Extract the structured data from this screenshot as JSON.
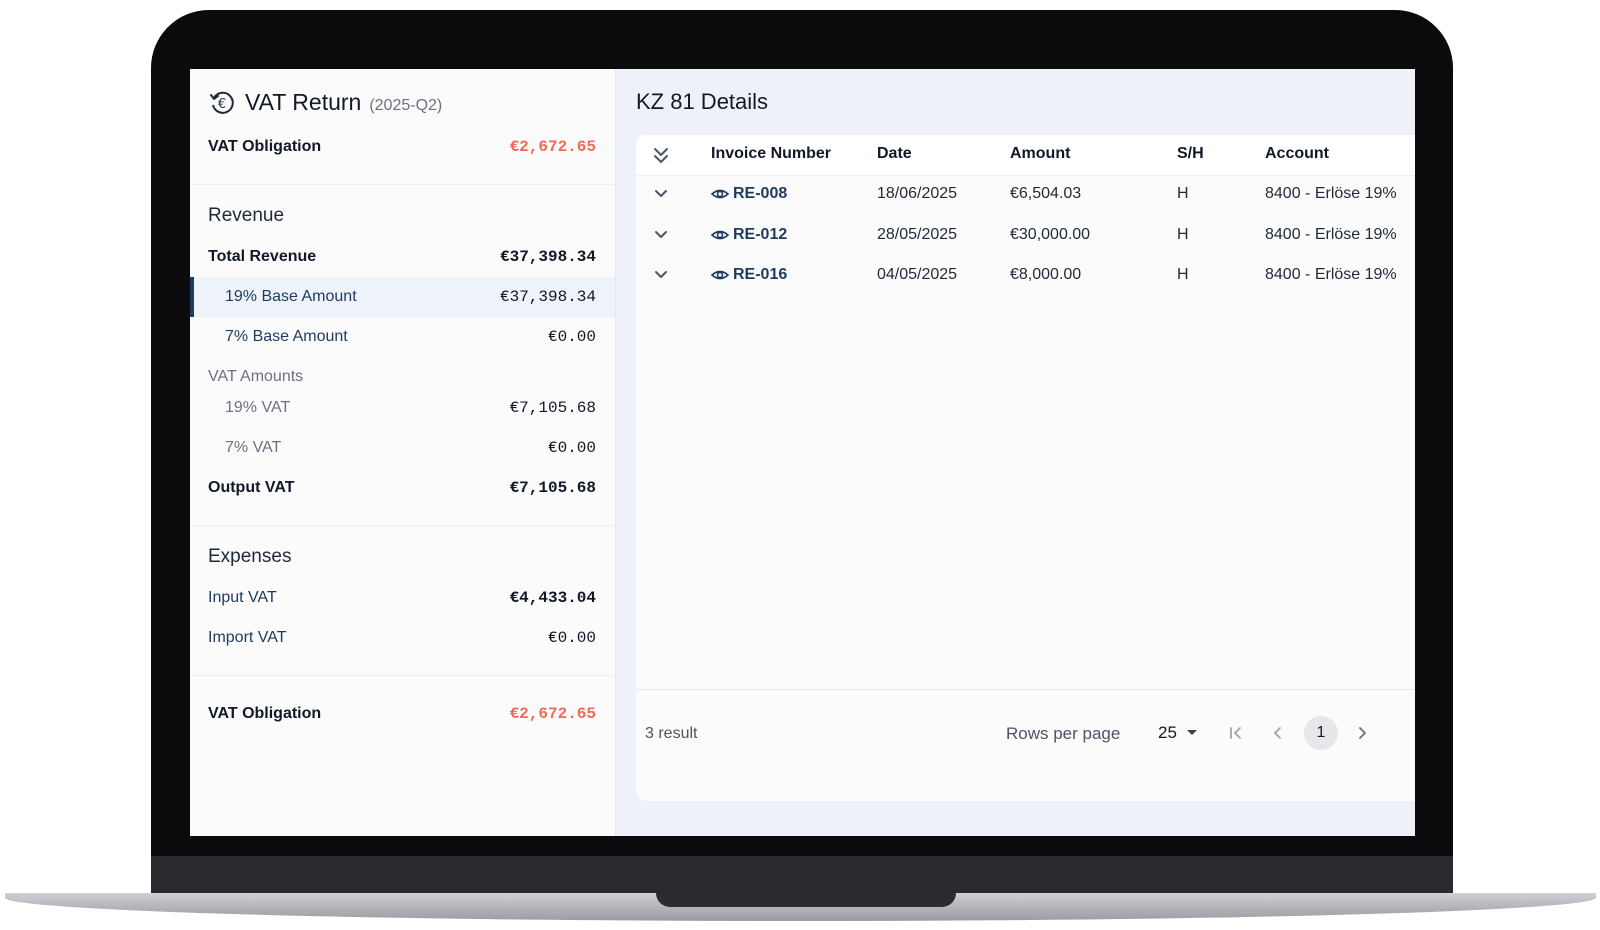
{
  "summary": {
    "title": "VAT Return",
    "period": "(2025-Q2)",
    "vat_obligation_label": "VAT Obligation",
    "vat_obligation_value": "€2,672.65",
    "revenue_heading": "Revenue",
    "total_revenue_label": "Total Revenue",
    "total_revenue_value": "€37,398.34",
    "base19_label": "19% Base Amount",
    "base19_value": "€37,398.34",
    "base7_label": "7% Base Amount",
    "base7_value": "€0.00",
    "vat_amounts_label": "VAT Amounts",
    "vat19_label": "19% VAT",
    "vat19_value": "€7,105.68",
    "vat7_label": "7% VAT",
    "vat7_value": "€0.00",
    "output_vat_label": "Output VAT",
    "output_vat_value": "€7,105.68",
    "expenses_heading": "Expenses",
    "input_vat_label": "Input VAT",
    "input_vat_value": "€4,433.04",
    "import_vat_label": "Import VAT",
    "import_vat_value": "€0.00",
    "footer_obligation_label": "VAT Obligation",
    "footer_obligation_value": "€2,672.65"
  },
  "details": {
    "title": "KZ 81 Details",
    "columns": [
      "Invoice Number",
      "Date",
      "Amount",
      "S/H",
      "Account"
    ],
    "rows": [
      {
        "invoice": "RE-008",
        "date": "18/06/2025",
        "amount": "€6,504.03",
        "sh": "H",
        "account": "8400 - Erlöse 19%"
      },
      {
        "invoice": "RE-012",
        "date": "28/05/2025",
        "amount": "€30,000.00",
        "sh": "H",
        "account": "8400 - Erlöse 19%"
      },
      {
        "invoice": "RE-016",
        "date": "04/05/2025",
        "amount": "€8,000.00",
        "sh": "H",
        "account": "8400 - Erlöse 19%"
      }
    ],
    "footer": {
      "result_count": "3 result",
      "rows_per_page_label": "Rows per page",
      "rows_per_page_value": "25",
      "current_page": "1"
    }
  },
  "colors": {
    "accent": "#1e3a5f",
    "obligation_red": "#f06a5a",
    "highlight_bg": "#eef2f9"
  },
  "icons": {
    "title": "euro-refresh-icon",
    "expand_all": "double-chevron-down-icon",
    "row_expand": "chevron-down-icon",
    "view": "eye-icon",
    "first_page": "first-page-icon",
    "prev_page": "chevron-left-icon",
    "next_page": "chevron-right-icon",
    "dropdown": "caret-down-icon"
  }
}
